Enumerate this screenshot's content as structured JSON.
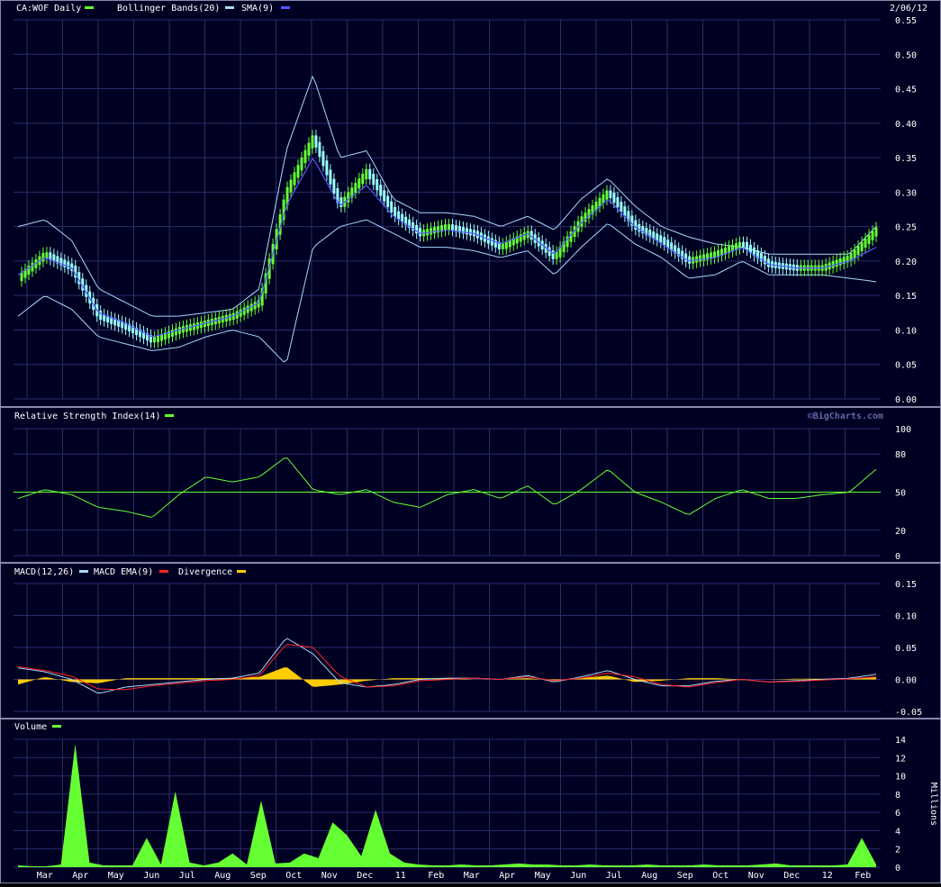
{
  "meta": {
    "symbol_label": "CA:WOF Daily",
    "date_label": "2/06/12",
    "watermark": "©BigCharts.com"
  },
  "colors": {
    "background": "#000022",
    "grid": "#2c2c6a",
    "text": "#ffffff",
    "price_up": "#66ff33",
    "price_down": "#99ffff",
    "bollinger": "#a8d8ff",
    "sma": "#5555ff",
    "rsi": "#66ff33",
    "macd": "#a8d8ff",
    "macd_ema": "#ff2222",
    "divergence": "#ffcc00",
    "volume": "#66ff33"
  },
  "legends": {
    "price": [
      "CA:WOF Daily",
      "Bollinger Bands(20)",
      "SMA(9)"
    ],
    "rsi": "Relative Strength Index(14)",
    "macd": [
      "MACD(12,26)",
      "MACD EMA(9)",
      "Divergence"
    ],
    "volume": "Volume",
    "volume_unit": "Millions"
  },
  "chart_data": [
    {
      "type": "line",
      "panel": "price",
      "title": "CA:WOF Daily",
      "x": [
        "Mar",
        "Apr",
        "May",
        "Jun",
        "Jul",
        "Aug",
        "Sep",
        "Oct",
        "Nov",
        "Dec",
        "11",
        "Feb",
        "Mar",
        "Apr",
        "May",
        "Jun",
        "Jul",
        "Aug",
        "Sep",
        "Oct",
        "Nov",
        "Dec",
        "12",
        "Feb"
      ],
      "ylim": [
        0,
        0.55
      ],
      "yticks": [
        "0.00",
        "0.05",
        "0.10",
        "0.15",
        "0.20",
        "0.25",
        "0.30",
        "0.35",
        "0.40",
        "0.45",
        "0.50",
        "0.55"
      ],
      "series": [
        {
          "name": "CA:WOF Daily",
          "values": [
            0.175,
            0.21,
            0.19,
            0.12,
            0.105,
            0.085,
            0.1,
            0.11,
            0.12,
            0.14,
            0.3,
            0.38,
            0.28,
            0.33,
            0.27,
            0.24,
            0.25,
            0.24,
            0.22,
            0.24,
            0.205,
            0.26,
            0.3,
            0.25,
            0.23,
            0.2,
            0.21,
            0.225,
            0.195,
            0.19,
            0.19,
            0.205,
            0.245
          ]
        },
        {
          "name": "Bollinger Bands(20)",
          "values": [
            0.25,
            0.26,
            0.23,
            0.16,
            0.14,
            0.12,
            0.12,
            0.125,
            0.13,
            0.16,
            0.36,
            0.47,
            0.35,
            0.36,
            0.29,
            0.27,
            0.27,
            0.265,
            0.25,
            0.265,
            0.245,
            0.29,
            0.32,
            0.28,
            0.25,
            0.235,
            0.225,
            0.22,
            0.21,
            0.21,
            0.21,
            0.21,
            0.25
          ]
        },
        {
          "name": "Bollinger Bands(20) lower",
          "values": [
            0.12,
            0.15,
            0.13,
            0.09,
            0.08,
            0.07,
            0.075,
            0.09,
            0.1,
            0.09,
            0.05,
            0.22,
            0.25,
            0.26,
            0.24,
            0.22,
            0.22,
            0.215,
            0.205,
            0.215,
            0.18,
            0.22,
            0.255,
            0.225,
            0.205,
            0.175,
            0.18,
            0.2,
            0.18,
            0.18,
            0.18,
            0.175,
            0.17
          ]
        },
        {
          "name": "SMA(9)",
          "values": [
            0.18,
            0.205,
            0.19,
            0.125,
            0.11,
            0.09,
            0.1,
            0.11,
            0.12,
            0.14,
            0.28,
            0.35,
            0.28,
            0.31,
            0.265,
            0.24,
            0.245,
            0.24,
            0.225,
            0.24,
            0.21,
            0.255,
            0.29,
            0.25,
            0.225,
            0.2,
            0.205,
            0.22,
            0.195,
            0.19,
            0.19,
            0.2,
            0.22
          ]
        }
      ]
    },
    {
      "type": "line",
      "panel": "rsi",
      "title": "Relative Strength Index(14)",
      "ylim": [
        0,
        100
      ],
      "yticks": [
        "0",
        "20",
        "50",
        "80",
        "100"
      ],
      "reference_line": 50,
      "series": [
        {
          "name": "Relative Strength Index(14)",
          "values": [
            45,
            52,
            48,
            38,
            35,
            30,
            48,
            62,
            58,
            62,
            78,
            52,
            48,
            52,
            42,
            38,
            48,
            52,
            45,
            55,
            40,
            52,
            68,
            50,
            42,
            32,
            45,
            52,
            45,
            45,
            48,
            50,
            68
          ]
        }
      ]
    },
    {
      "type": "line",
      "panel": "macd",
      "title": "MACD(12,26)",
      "ylim": [
        -0.05,
        0.15
      ],
      "yticks": [
        "-0.05",
        "0.00",
        "0.05",
        "0.10",
        "0.15"
      ],
      "series": [
        {
          "name": "MACD(12,26)",
          "values": [
            0.018,
            0.012,
            0.0,
            -0.022,
            -0.012,
            -0.008,
            -0.004,
            0.0,
            0.002,
            0.01,
            0.065,
            0.04,
            -0.005,
            -0.012,
            -0.008,
            0.0,
            0.002,
            0.002,
            0.0,
            0.006,
            -0.004,
            0.004,
            0.014,
            0.0,
            -0.01,
            -0.01,
            -0.003,
            0.0,
            -0.004,
            -0.002,
            0.0,
            0.002,
            0.008
          ]
        },
        {
          "name": "MACD EMA(9)",
          "values": [
            0.02,
            0.014,
            0.005,
            -0.015,
            -0.016,
            -0.01,
            -0.006,
            -0.002,
            0.0,
            0.006,
            0.055,
            0.05,
            0.005,
            -0.012,
            -0.01,
            -0.002,
            0.0,
            0.002,
            0.0,
            0.004,
            -0.002,
            0.002,
            0.01,
            0.004,
            -0.008,
            -0.012,
            -0.005,
            0.0,
            -0.004,
            -0.003,
            -0.001,
            0.001,
            0.004
          ]
        },
        {
          "name": "Divergence",
          "values": [
            -0.008,
            0.004,
            -0.004,
            -0.006,
            0.002,
            0.002,
            0.002,
            0.002,
            0.002,
            0.004,
            0.02,
            -0.012,
            -0.008,
            -0.002,
            0.002,
            0.002,
            0.002,
            0.0,
            0.0,
            0.002,
            -0.002,
            0.002,
            0.006,
            -0.004,
            -0.002,
            0.002,
            0.002,
            0.0,
            0.0,
            0.001,
            0.001,
            0.001,
            0.004
          ]
        }
      ]
    },
    {
      "type": "bar",
      "panel": "volume",
      "title": "Volume",
      "ylabel": "Millions",
      "ylim": [
        0,
        14
      ],
      "yticks": [
        "0",
        "2",
        "4",
        "6",
        "8",
        "10",
        "12",
        "14"
      ],
      "series": [
        {
          "name": "Volume",
          "values": [
            0.2,
            0.1,
            0.1,
            0.3,
            13.5,
            0.5,
            0.2,
            0.2,
            0.2,
            3.2,
            0.3,
            8.3,
            0.5,
            0.2,
            0.5,
            1.5,
            0.3,
            7.3,
            0.4,
            0.5,
            1.5,
            1.0,
            4.9,
            3.5,
            1.2,
            6.3,
            1.5,
            0.5,
            0.3,
            0.2,
            0.2,
            0.3,
            0.2,
            0.2,
            0.3,
            0.4,
            0.3,
            0.3,
            0.2,
            0.2,
            0.3,
            0.2,
            0.2,
            0.2,
            0.3,
            0.2,
            0.2,
            0.2,
            0.3,
            0.2,
            0.2,
            0.2,
            0.3,
            0.4,
            0.2,
            0.2,
            0.2,
            0.2,
            0.3,
            3.2,
            0.3
          ]
        }
      ]
    }
  ]
}
